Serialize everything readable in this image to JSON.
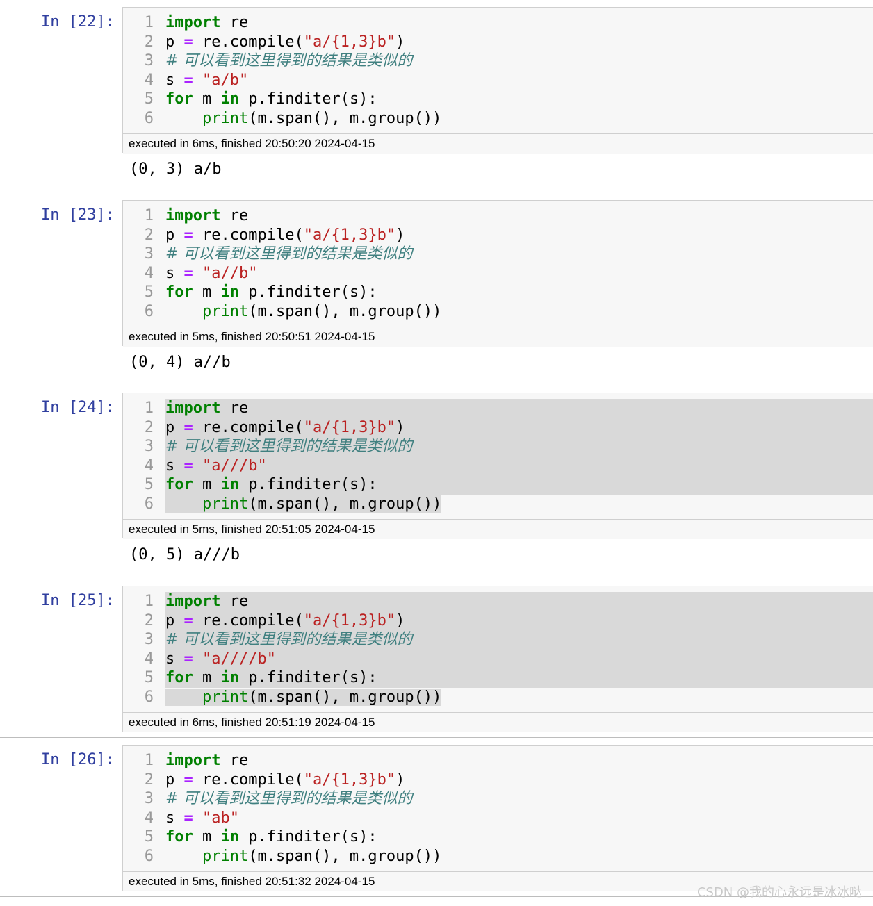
{
  "cells": [
    {
      "prompt": "In [22]:",
      "line_numbers": [
        "1",
        "2",
        "3",
        "4",
        "5",
        "6"
      ],
      "string_value": "\"a/b\"",
      "exec_info": "executed in 6ms, finished 20:50:20 2024-04-15",
      "output": "(0, 3) a/b",
      "selected": false
    },
    {
      "prompt": "In [23]:",
      "line_numbers": [
        "1",
        "2",
        "3",
        "4",
        "5",
        "6"
      ],
      "string_value": "\"a//b\"",
      "exec_info": "executed in 5ms, finished 20:50:51 2024-04-15",
      "output": "(0, 4) a//b",
      "selected": false
    },
    {
      "prompt": "In [24]:",
      "line_numbers": [
        "1",
        "2",
        "3",
        "4",
        "5",
        "6"
      ],
      "string_value": "\"a///b\"",
      "exec_info": "executed in 5ms, finished 20:51:05 2024-04-15",
      "output": "(0, 5) a///b",
      "selected": true
    },
    {
      "prompt": "In [25]:",
      "line_numbers": [
        "1",
        "2",
        "3",
        "4",
        "5",
        "6"
      ],
      "string_value": "\"a////b\"",
      "exec_info": "executed in 6ms, finished 20:51:19 2024-04-15",
      "output": "",
      "selected": true
    },
    {
      "prompt": "In [26]:",
      "line_numbers": [
        "1",
        "2",
        "3",
        "4",
        "5",
        "6"
      ],
      "string_value": "\"ab\"",
      "exec_info": "executed in 5ms, finished 20:51:32 2024-04-15",
      "output": "",
      "selected": false
    }
  ],
  "code": {
    "kw_import": "import",
    "mod_re": " re",
    "var_p": "p ",
    "op_eq": "=",
    "re_compile": " re.compile(",
    "pattern_str": "\"a/{1,3}b\"",
    "close_paren": ")",
    "comment": "# 可以看到这里得到的结果是类似的",
    "var_s": "s ",
    "space": " ",
    "kw_for": "for",
    "var_m": " m ",
    "kw_in": "in",
    "finditer": " p.finditer(s):",
    "indent": "    ",
    "bi_print": "print",
    "print_args": "(m.span(), m.group())"
  },
  "watermark": "CSDN @我的心永远是冰冰哒",
  "colors": {
    "prompt": "#303f9f",
    "keyword": "#008000",
    "operator": "#aa22ff",
    "string": "#ba2121",
    "comment": "#408080",
    "selection": "#d9d9d9",
    "cell_bg": "#f7f7f7"
  }
}
